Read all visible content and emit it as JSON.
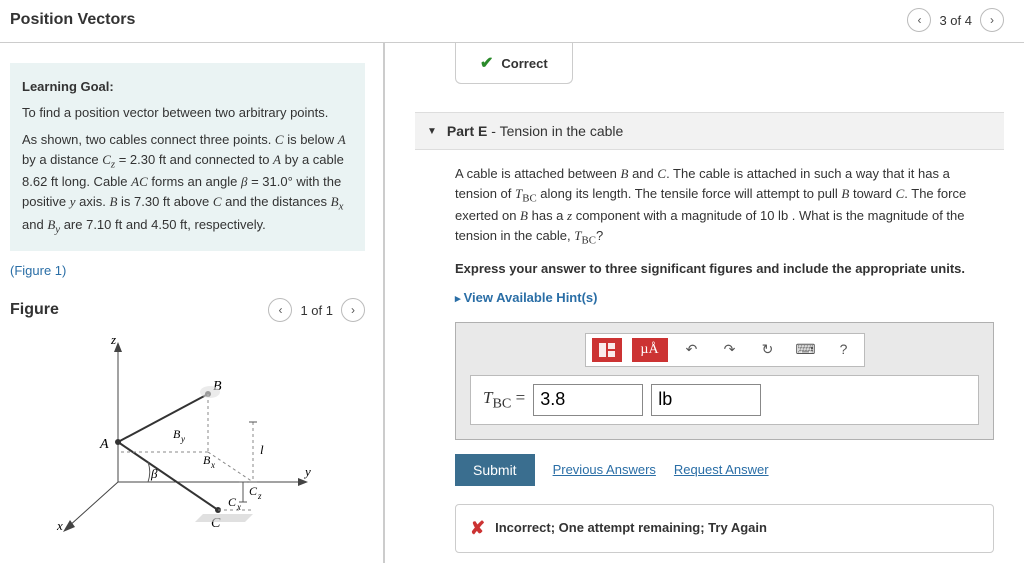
{
  "header": {
    "title": "Position Vectors",
    "page_label": "3 of 4"
  },
  "left": {
    "goal_title": "Learning Goal:",
    "goal_intro": "To find a position vector between two arbitrary points.",
    "goal_body_html": "As shown, two cables connect three points. <span class='serif-i'>C</span> is below <span class='serif-i'>A</span> by a distance <span class='serif-i'>C<sub>z</sub></span> = 2.30 ft and connected to <span class='serif-i'>A</span> by a cable 8.62 ft long. Cable <span class='serif-i'>AC</span> forms an angle <span class='serif-i'>β</span> = 31.0° with the positive <span class='serif-i'>y</span> axis. <span class='serif-i'>B</span> is 7.30 ft above <span class='serif-i'>C</span> and the distances <span class='serif-i'>B<sub>x</sub></span> and <span class='serif-i'>B<sub>y</sub></span> are 7.10 ft and 4.50 ft, respectively.",
    "figure_link": "(Figure 1)",
    "figure_heading": "Figure",
    "figure_page": "1 of 1",
    "diagram": {
      "labels": [
        "z",
        "A",
        "B",
        "B_y",
        "B_x",
        "l",
        "β",
        "C_z",
        "C_x",
        "C",
        "y",
        "x"
      ]
    }
  },
  "right": {
    "correct_label": "Correct",
    "part_label": "Part E",
    "part_title": "Tension in the cable",
    "prompt_html": "A cable is attached between <span class='serif-i'>B</span> and <span class='serif-i'>C</span>. The cable is attached in such a way that it has a tension of <span class='serif-i'>T</span><span class='serif'><sub>BC</sub></span> along its length. The tensile force will attempt to pull <span class='serif-i'>B</span> toward <span class='serif-i'>C</span>. The force exerted on <span class='serif-i'>B</span> has a <span class='serif-i'>z</span> component with a magnitude of 10 lb . What is the magnitude of the tension in the cable, <span class='serif-i'>T</span><span class='serif'><sub>BC</sub></span>?",
    "instruction": "Express your answer to three significant figures and include the appropriate units.",
    "hints": "View Available Hint(s)",
    "answer": {
      "lhs_html": "<span class='serif-i'>T</span><sub class='serif' style='font-style:normal;'>BC</sub> =",
      "value": "3.8",
      "unit": "lb",
      "toolbar_mu": "µÅ",
      "toolbar_q": "?"
    },
    "submit": "Submit",
    "prev_answers": "Previous Answers",
    "request_answer": "Request Answer",
    "feedback": "Incorrect; One attempt remaining; Try Again"
  }
}
